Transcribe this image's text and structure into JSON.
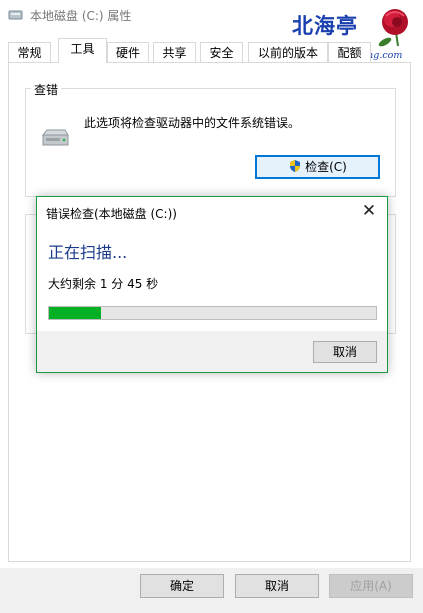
{
  "window": {
    "title": "本地磁盘 (C:) 属性"
  },
  "watermark": {
    "brand": "北海亭",
    "url": "http://www.beihaiting.com"
  },
  "tabs": [
    {
      "label": "常规"
    },
    {
      "label": "工具",
      "active": true
    },
    {
      "label": "硬件"
    },
    {
      "label": "共享"
    },
    {
      "label": "安全"
    },
    {
      "label": "以前的版本"
    },
    {
      "label": "配额"
    }
  ],
  "error_check": {
    "group_label": "查错",
    "description": "此选项将检查驱动器中的文件系统错误。",
    "check_button": "检查(C)"
  },
  "dialog": {
    "title": "错误检查(本地磁盘 (C:))",
    "status": "正在扫描...",
    "time_remaining": "大约剩余 1 分 45 秒",
    "progress": 0.16,
    "cancel_button": "取消"
  },
  "footer": {
    "ok_button": "确定",
    "cancel_button": "取消",
    "apply_button": "应用(A)"
  },
  "colors": {
    "progress_fill": "#06b025",
    "dialog_border": "#1a9a3e",
    "status_text": "#1b3b8a",
    "watermark": "#1a3fae"
  }
}
